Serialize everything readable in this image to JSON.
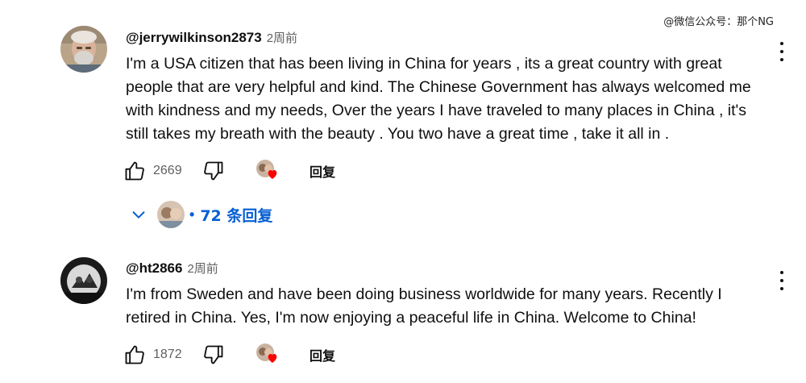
{
  "watermark": "@微信公众号：那个NG",
  "comments": [
    {
      "author": "@jerrywilkinson2873",
      "time": "2周前",
      "text": "I'm a USA citizen that has been living in China for years , its a great country with great people that are very helpful and kind. The Chinese Government has always welcomed me with kindness and my needs, Over the years I have traveled to many places in China , it's still takes my breath with the beauty . You two have a great time , take it all in .",
      "like_count": "2669",
      "reply_label": "回复",
      "replies_label": "72 条回复"
    },
    {
      "author": "@ht2866",
      "time": "2周前",
      "text": "I'm from Sweden and have been doing business worldwide for many years. Recently I retired in China. Yes, I'm now enjoying a peaceful life in China. Welcome to China!",
      "like_count": "1872",
      "reply_label": "回复"
    }
  ],
  "icons": {
    "like": "thumb-up-icon",
    "dislike": "thumb-down-icon",
    "more": "more-vert-icon",
    "expand": "chevron-down-icon",
    "creator_heart": "creator-heart-icon"
  },
  "colors": {
    "link_blue": "#065fd4",
    "heart_red": "#ff0000",
    "secondary_text": "#606060"
  }
}
